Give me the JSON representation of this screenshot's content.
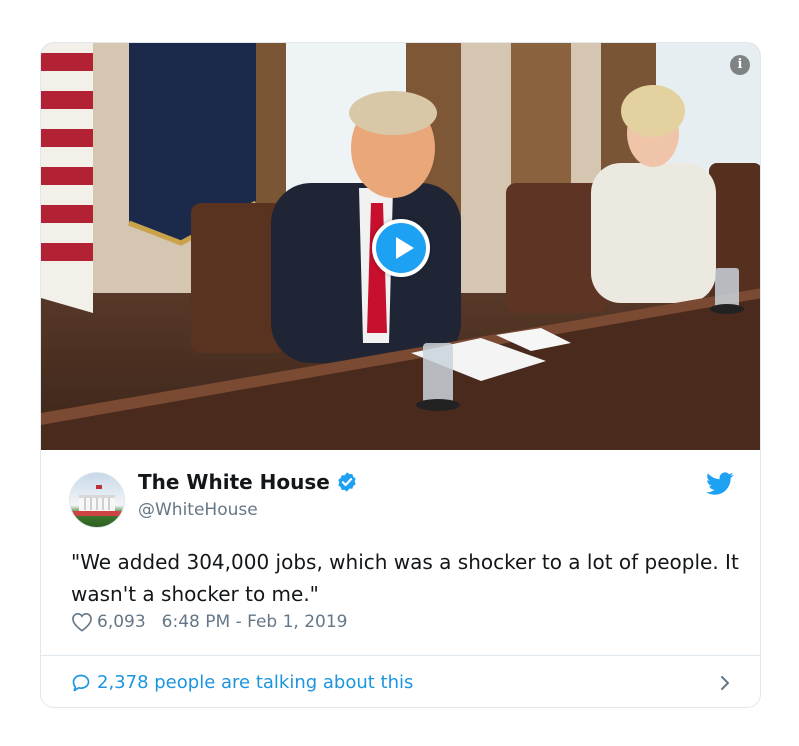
{
  "media": {
    "info_icon": "info-icon",
    "play_icon": "play-icon"
  },
  "tweet": {
    "display_name": "The White House",
    "handle": "@WhiteHouse",
    "verified_icon": "verified-badge-icon",
    "brand_icon": "twitter-bird-icon",
    "text": "\"We added 304,000 jobs, which was a shocker to a lot of people. It wasn't a shocker to me.\"",
    "likes": "6,093",
    "timestamp": "6:48 PM - Feb 1, 2019"
  },
  "footer": {
    "talking": "2,378 people are talking about this"
  },
  "colors": {
    "accent": "#1da1f2",
    "link": "#1b95e0",
    "text": "#14171a",
    "muted": "#657786",
    "border": "#e1e8ed"
  }
}
